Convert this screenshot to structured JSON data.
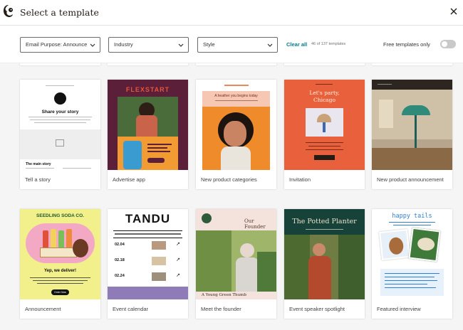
{
  "header": {
    "title": "Select a template"
  },
  "filters": {
    "email_purpose": "Email Purpose: Announce",
    "industry": "Industry",
    "style": "Style",
    "clear_all": "Clear all",
    "count": "46 of 137 templates",
    "free_only": "Free templates only",
    "free_only_enabled": false
  },
  "templates": [
    {
      "label": "Tell a story",
      "thumb": {
        "heading": "Share your story",
        "section": "The main story"
      }
    },
    {
      "label": "Advertise app",
      "thumb": {
        "brand": "FLEXSTART"
      }
    },
    {
      "label": "New product categories",
      "thumb": {
        "headline": "A heather you begins today"
      }
    },
    {
      "label": "Invitation",
      "thumb": {
        "headline_1": "Let's party,",
        "headline_2": "Chicago"
      }
    },
    {
      "label": "New product announcement",
      "thumb": {}
    },
    {
      "label": "Announcement",
      "thumb": {
        "brand": "SEEDLING SODA CO.",
        "headline": "Yep, we deliver!",
        "button": "Order Now"
      }
    },
    {
      "label": "Event calendar",
      "thumb": {
        "brand": "TANDU",
        "dates": [
          "02.04",
          "02.18",
          "02.24"
        ]
      }
    },
    {
      "label": "Meet the founder",
      "thumb": {
        "headline": "Our Founder",
        "caption": "A Young Green Thumb"
      }
    },
    {
      "label": "Event speaker spotlight",
      "thumb": {
        "headline": "The Potted Planter"
      }
    },
    {
      "label": "Featured interview",
      "thumb": {
        "headline": "happy tails"
      }
    }
  ],
  "colors": {
    "teal": "#007c89",
    "flexstart_bg": "#5c1f3a",
    "flexstart_accent": "#e3543a",
    "invitation_bg": "#e8603c",
    "potted_bg": "#17423a",
    "soda_bg": "#f2f08a",
    "tandu_purple": "#8f7bb8"
  }
}
